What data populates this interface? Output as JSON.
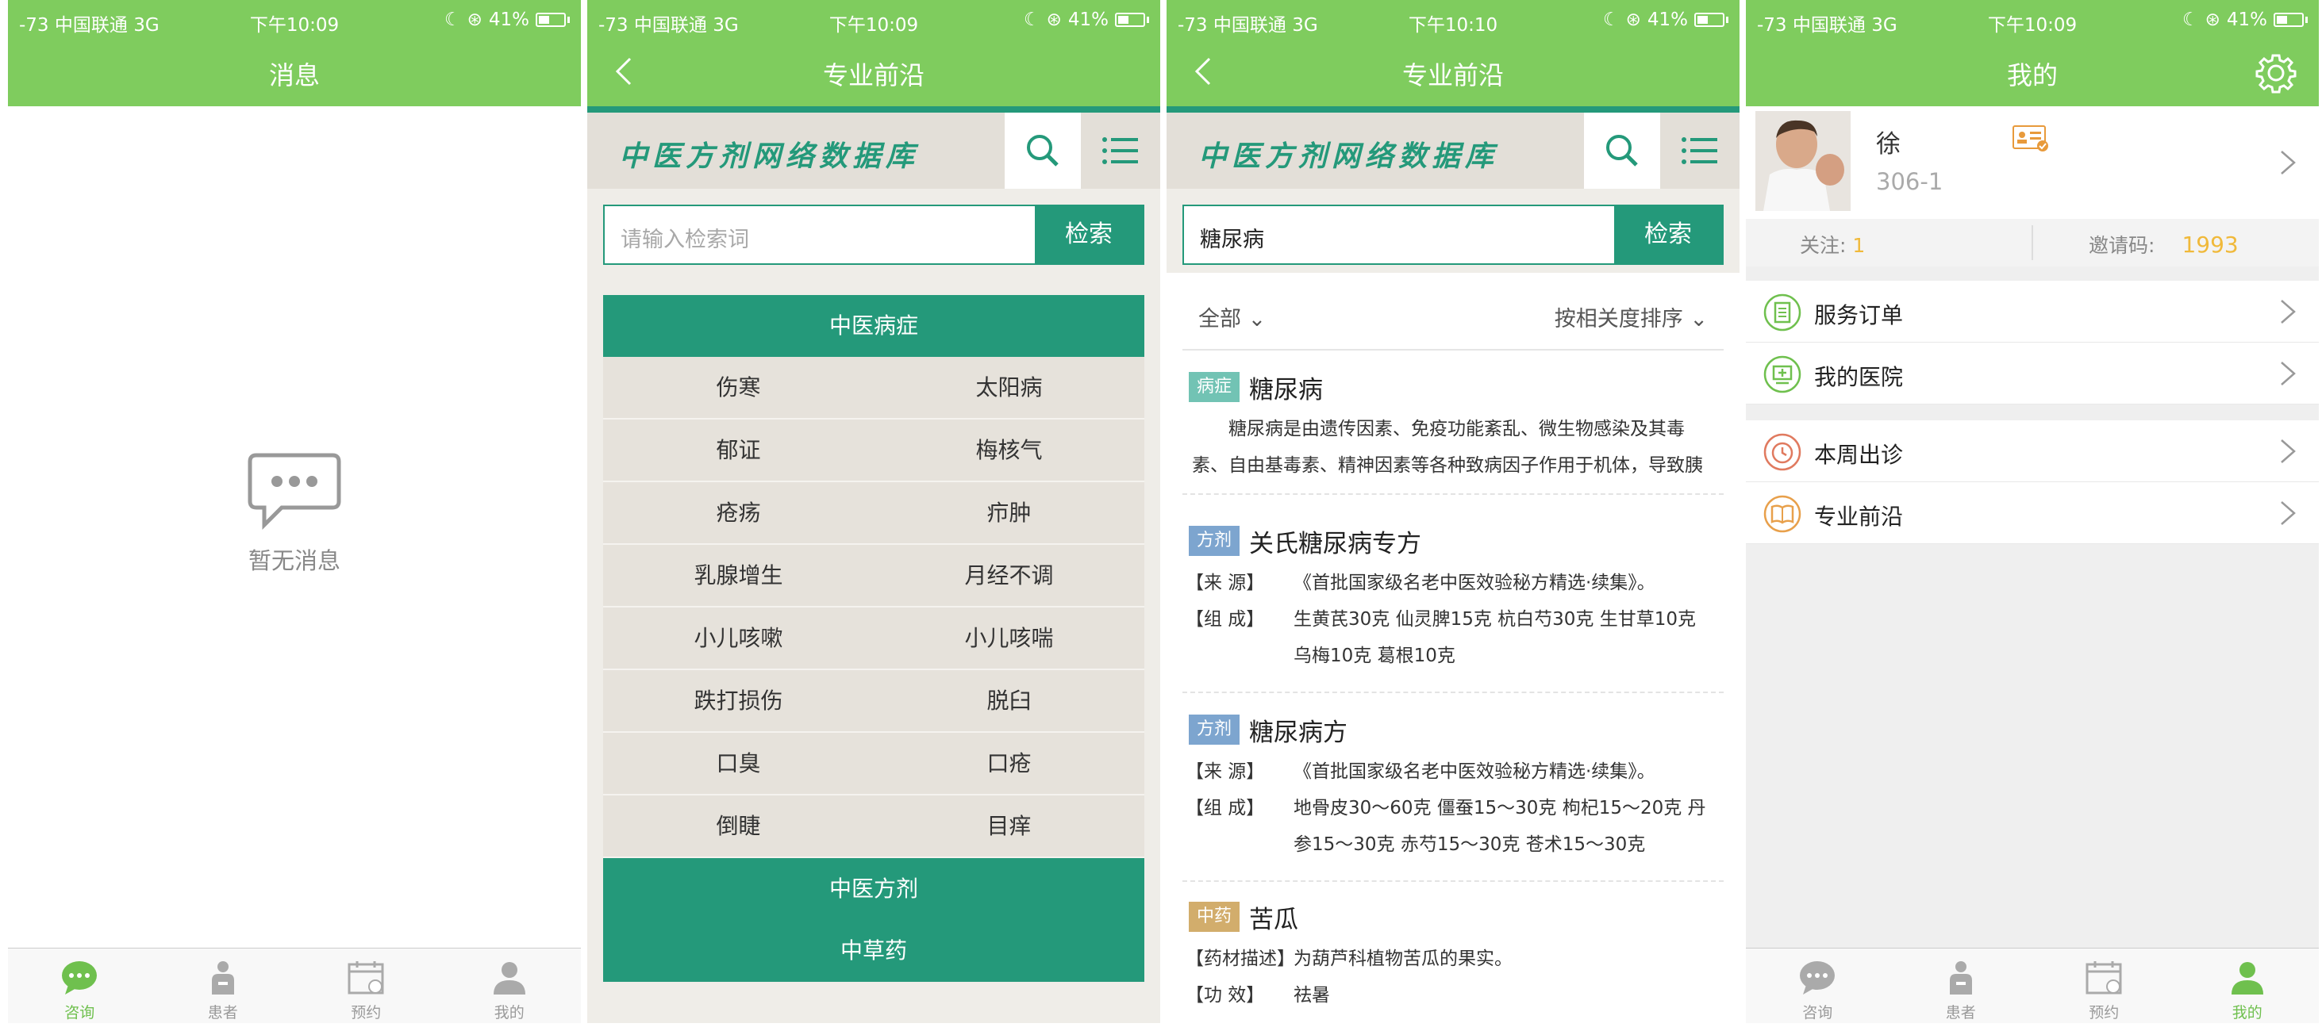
{
  "status": {
    "carrier": "-73 中国联通   3G",
    "battery": "41%",
    "time_1": "下午10:09",
    "time_2": "下午10:09",
    "time_3": "下午10:10",
    "time_4": "下午10:09"
  },
  "tabs": [
    "咨询",
    "患者",
    "预约",
    "我的"
  ],
  "screen1": {
    "title": "消息",
    "empty_text": "暂无消息"
  },
  "db": {
    "nav_title": "专业前沿",
    "header_title": "中医方剂网络数据库",
    "search_placeholder": "请输入检索词",
    "search_button": "检索"
  },
  "screen2": {
    "category_1": "中医病症",
    "items": [
      "伤寒",
      "太阳病",
      "郁证",
      "梅核气",
      "疮疡",
      "疖肿",
      "乳腺增生",
      "月经不调",
      "小儿咳嗽",
      "小儿咳喘",
      "跌打损伤",
      "脱臼",
      "口臭",
      "口疮",
      "倒睫",
      "目痒"
    ],
    "category_2": "中医方剂",
    "category_3": "中草药"
  },
  "screen3": {
    "query": "糖尿病",
    "filter_left": "全部",
    "filter_right": "按相关度排序",
    "results": [
      {
        "tag": "病症",
        "tag_color": "#72c3b4",
        "title": "糖尿病",
        "desc": "糖尿病是由遗传因素、免疫功能紊乱、微生物感染及其毒素、自由基毒素、精神因素等各种致病因子作用于机体，导致胰"
      },
      {
        "tag": "方剂",
        "tag_color": "#7da5cf",
        "title": "关氏糖尿病专方",
        "source_key": "【来 源】",
        "source": "《首批国家级名老中医效验秘方精选·续集》。",
        "comp_key": "【组 成】",
        "comp": "生黄芪30克 仙灵脾15克 杭白芍30克 生甘草10克 乌梅10克 葛根10克"
      },
      {
        "tag": "方剂",
        "tag_color": "#7da5cf",
        "title": "糖尿病方",
        "source_key": "【来 源】",
        "source": "《首批国家级名老中医效验秘方精选·续集》。",
        "comp_key": "【组 成】",
        "comp": "地骨皮30～60克 僵蚕15～30克 枸杞15～20克 丹参15～30克 赤芍15～30克 苍术15～30克"
      },
      {
        "tag": "中药",
        "tag_color": "#d2ad6c",
        "title": "苦瓜",
        "desc_key": "【药材描述】",
        "desc": "为葫芦科植物苦瓜的果实。",
        "effect_key": "【功 效】",
        "effect": "祛暑"
      }
    ]
  },
  "screen4": {
    "title": "我的",
    "name": "徐",
    "id": "306-1",
    "follow_label": "关注:",
    "follow_value": "1",
    "invite_label": "邀请码:",
    "invite_value": "1993",
    "menu": [
      "服务订单",
      "我的医院",
      "本周出诊",
      "专业前沿"
    ]
  },
  "colors": {
    "app_green": "#7fcc5e",
    "teal": "#24997a",
    "orange": "#f0b93a"
  }
}
